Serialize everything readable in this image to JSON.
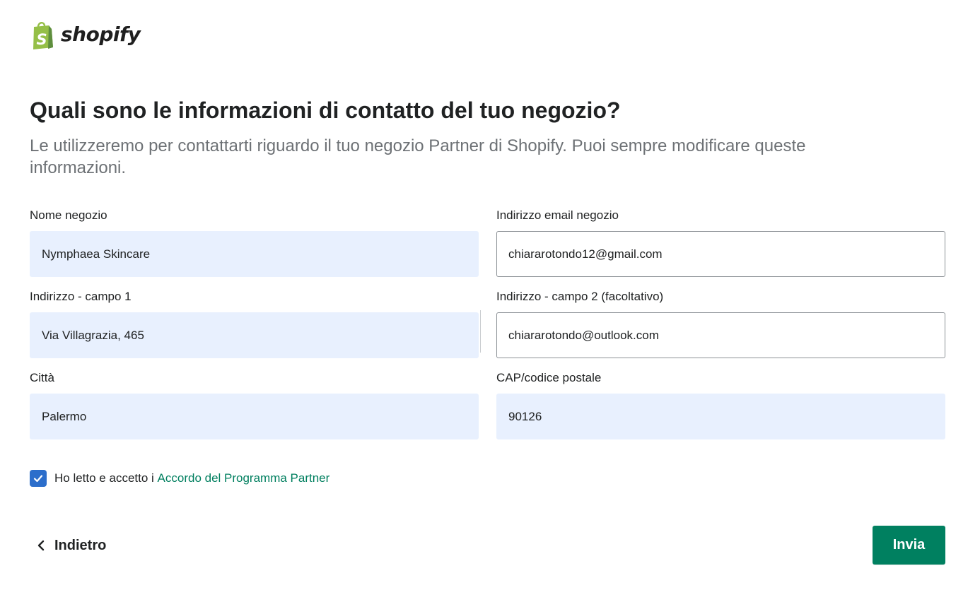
{
  "brand": {
    "name": "shopify",
    "logo_icon": "shopify-bag-icon",
    "color": "#95bf47"
  },
  "header": {
    "title": "Quali sono le informazioni di contatto del tuo negozio?",
    "subtitle": "Le utilizzeremo per contattarti riguardo il tuo negozio Partner di Shopify. Puoi sempre modificare queste informazioni."
  },
  "form": {
    "store_name": {
      "label": "Nome negozio",
      "value": "Nymphaea Skincare"
    },
    "store_email": {
      "label": "Indirizzo email negozio",
      "value": "chiararotondo12@gmail.com"
    },
    "address_line1": {
      "label": "Indirizzo - campo 1",
      "value": "Via Villagrazia, 465"
    },
    "address_line2": {
      "label": "Indirizzo - campo 2 (facoltativo)",
      "value": "chiararotondo@outlook.com"
    },
    "city": {
      "label": "Città",
      "value": "Palermo"
    },
    "postal_code": {
      "label": "CAP/codice postale",
      "value": "90126"
    }
  },
  "agreement": {
    "checked": true,
    "text": "Ho letto e accetto i ",
    "link_text": "Accordo del Programma Partner"
  },
  "actions": {
    "back_label": "Indietro",
    "back_icon": "chevron-left-icon",
    "submit_label": "Invia"
  },
  "colors": {
    "primary": "#008060",
    "checkbox": "#2c6ecb",
    "autofill_bg": "#e8f0fe",
    "link": "#007f5f"
  }
}
